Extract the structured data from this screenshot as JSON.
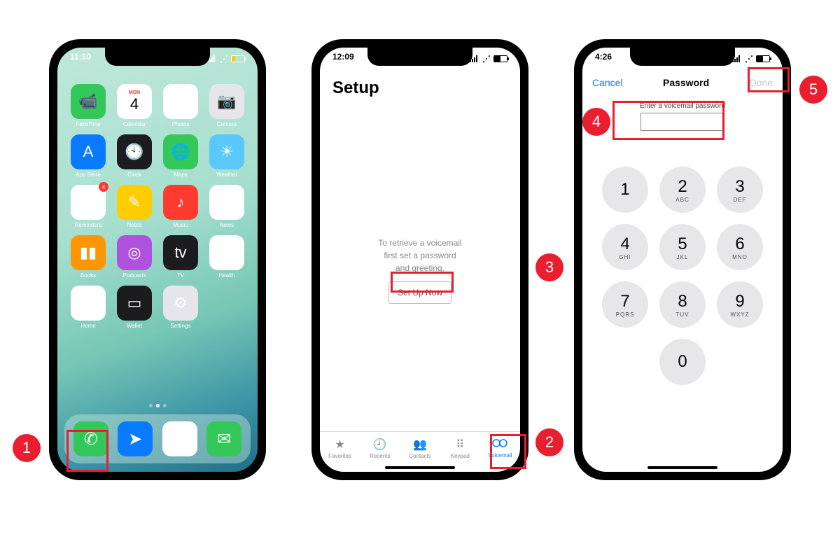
{
  "phone1": {
    "time": "11:10",
    "calendar_day": "MON",
    "calendar_date": "4",
    "apps": [
      {
        "label": "FaceTime",
        "icon": "📹",
        "bg": "bg-green"
      },
      {
        "label": "Calendar",
        "icon": "",
        "bg": "bg-white"
      },
      {
        "label": "Photos",
        "icon": "❁",
        "bg": "bg-white"
      },
      {
        "label": "Camera",
        "icon": "📷",
        "bg": "bg-grey"
      },
      {
        "label": "App Store",
        "icon": "A",
        "bg": "bg-blue"
      },
      {
        "label": "Clock",
        "icon": "🕙",
        "bg": "bg-dark"
      },
      {
        "label": "Maps",
        "icon": "🌐",
        "bg": "bg-green"
      },
      {
        "label": "Weather",
        "icon": "☀︎",
        "bg": "bg-lblue"
      },
      {
        "label": "Reminders",
        "icon": "≣",
        "bg": "bg-white",
        "badge": "4"
      },
      {
        "label": "Notes",
        "icon": "✎",
        "bg": "bg-yellow"
      },
      {
        "label": "Music",
        "icon": "♪",
        "bg": "bg-red"
      },
      {
        "label": "News",
        "icon": "N",
        "bg": "bg-white"
      },
      {
        "label": "Books",
        "icon": "▮▮",
        "bg": "bg-orange"
      },
      {
        "label": "Podcasts",
        "icon": "◎",
        "bg": "bg-purple"
      },
      {
        "label": "TV",
        "icon": "tv",
        "bg": "bg-dark"
      },
      {
        "label": "Health",
        "icon": "♥",
        "bg": "bg-white"
      },
      {
        "label": "Home",
        "icon": "⌂",
        "bg": "bg-white"
      },
      {
        "label": "Wallet",
        "icon": "▭",
        "bg": "bg-dark"
      },
      {
        "label": "Settings",
        "icon": "⚙︎",
        "bg": "bg-grey"
      }
    ],
    "dock": [
      {
        "name": "phone",
        "icon": "✆",
        "bg": "bg-green"
      },
      {
        "name": "mail",
        "icon": "➤",
        "bg": "bg-blue"
      },
      {
        "name": "safari",
        "icon": "◉",
        "bg": "bg-white"
      },
      {
        "name": "messages",
        "icon": "✉︎",
        "bg": "bg-green"
      }
    ]
  },
  "phone2": {
    "time": "12:09",
    "title": "Setup",
    "msg1": "To retrieve a voicemail",
    "msg2": "first set a password",
    "msg3": "and greeting.",
    "button": "Set Up Now",
    "tabs": [
      {
        "label": "Favorites",
        "icon": "★"
      },
      {
        "label": "Recents",
        "icon": "🕘"
      },
      {
        "label": "Contacts",
        "icon": "👥"
      },
      {
        "label": "Keypad",
        "icon": "⠿"
      },
      {
        "label": "Voicemail",
        "icon": "⌷⌷"
      }
    ]
  },
  "phone3": {
    "time": "4:26",
    "cancel": "Cancel",
    "title": "Password",
    "done": "Done",
    "enter_label": "Enter a voicemail password",
    "keys": [
      {
        "n": "1",
        "l": ""
      },
      {
        "n": "2",
        "l": "ABC"
      },
      {
        "n": "3",
        "l": "DEF"
      },
      {
        "n": "4",
        "l": "GHI"
      },
      {
        "n": "5",
        "l": "JKL"
      },
      {
        "n": "6",
        "l": "MNO"
      },
      {
        "n": "7",
        "l": "PQRS"
      },
      {
        "n": "8",
        "l": "TUV"
      },
      {
        "n": "9",
        "l": "WXYZ"
      },
      {
        "n": "0",
        "l": ""
      }
    ]
  },
  "callouts": {
    "c1": "1",
    "c2": "2",
    "c3": "3",
    "c4": "4",
    "c5": "5"
  }
}
